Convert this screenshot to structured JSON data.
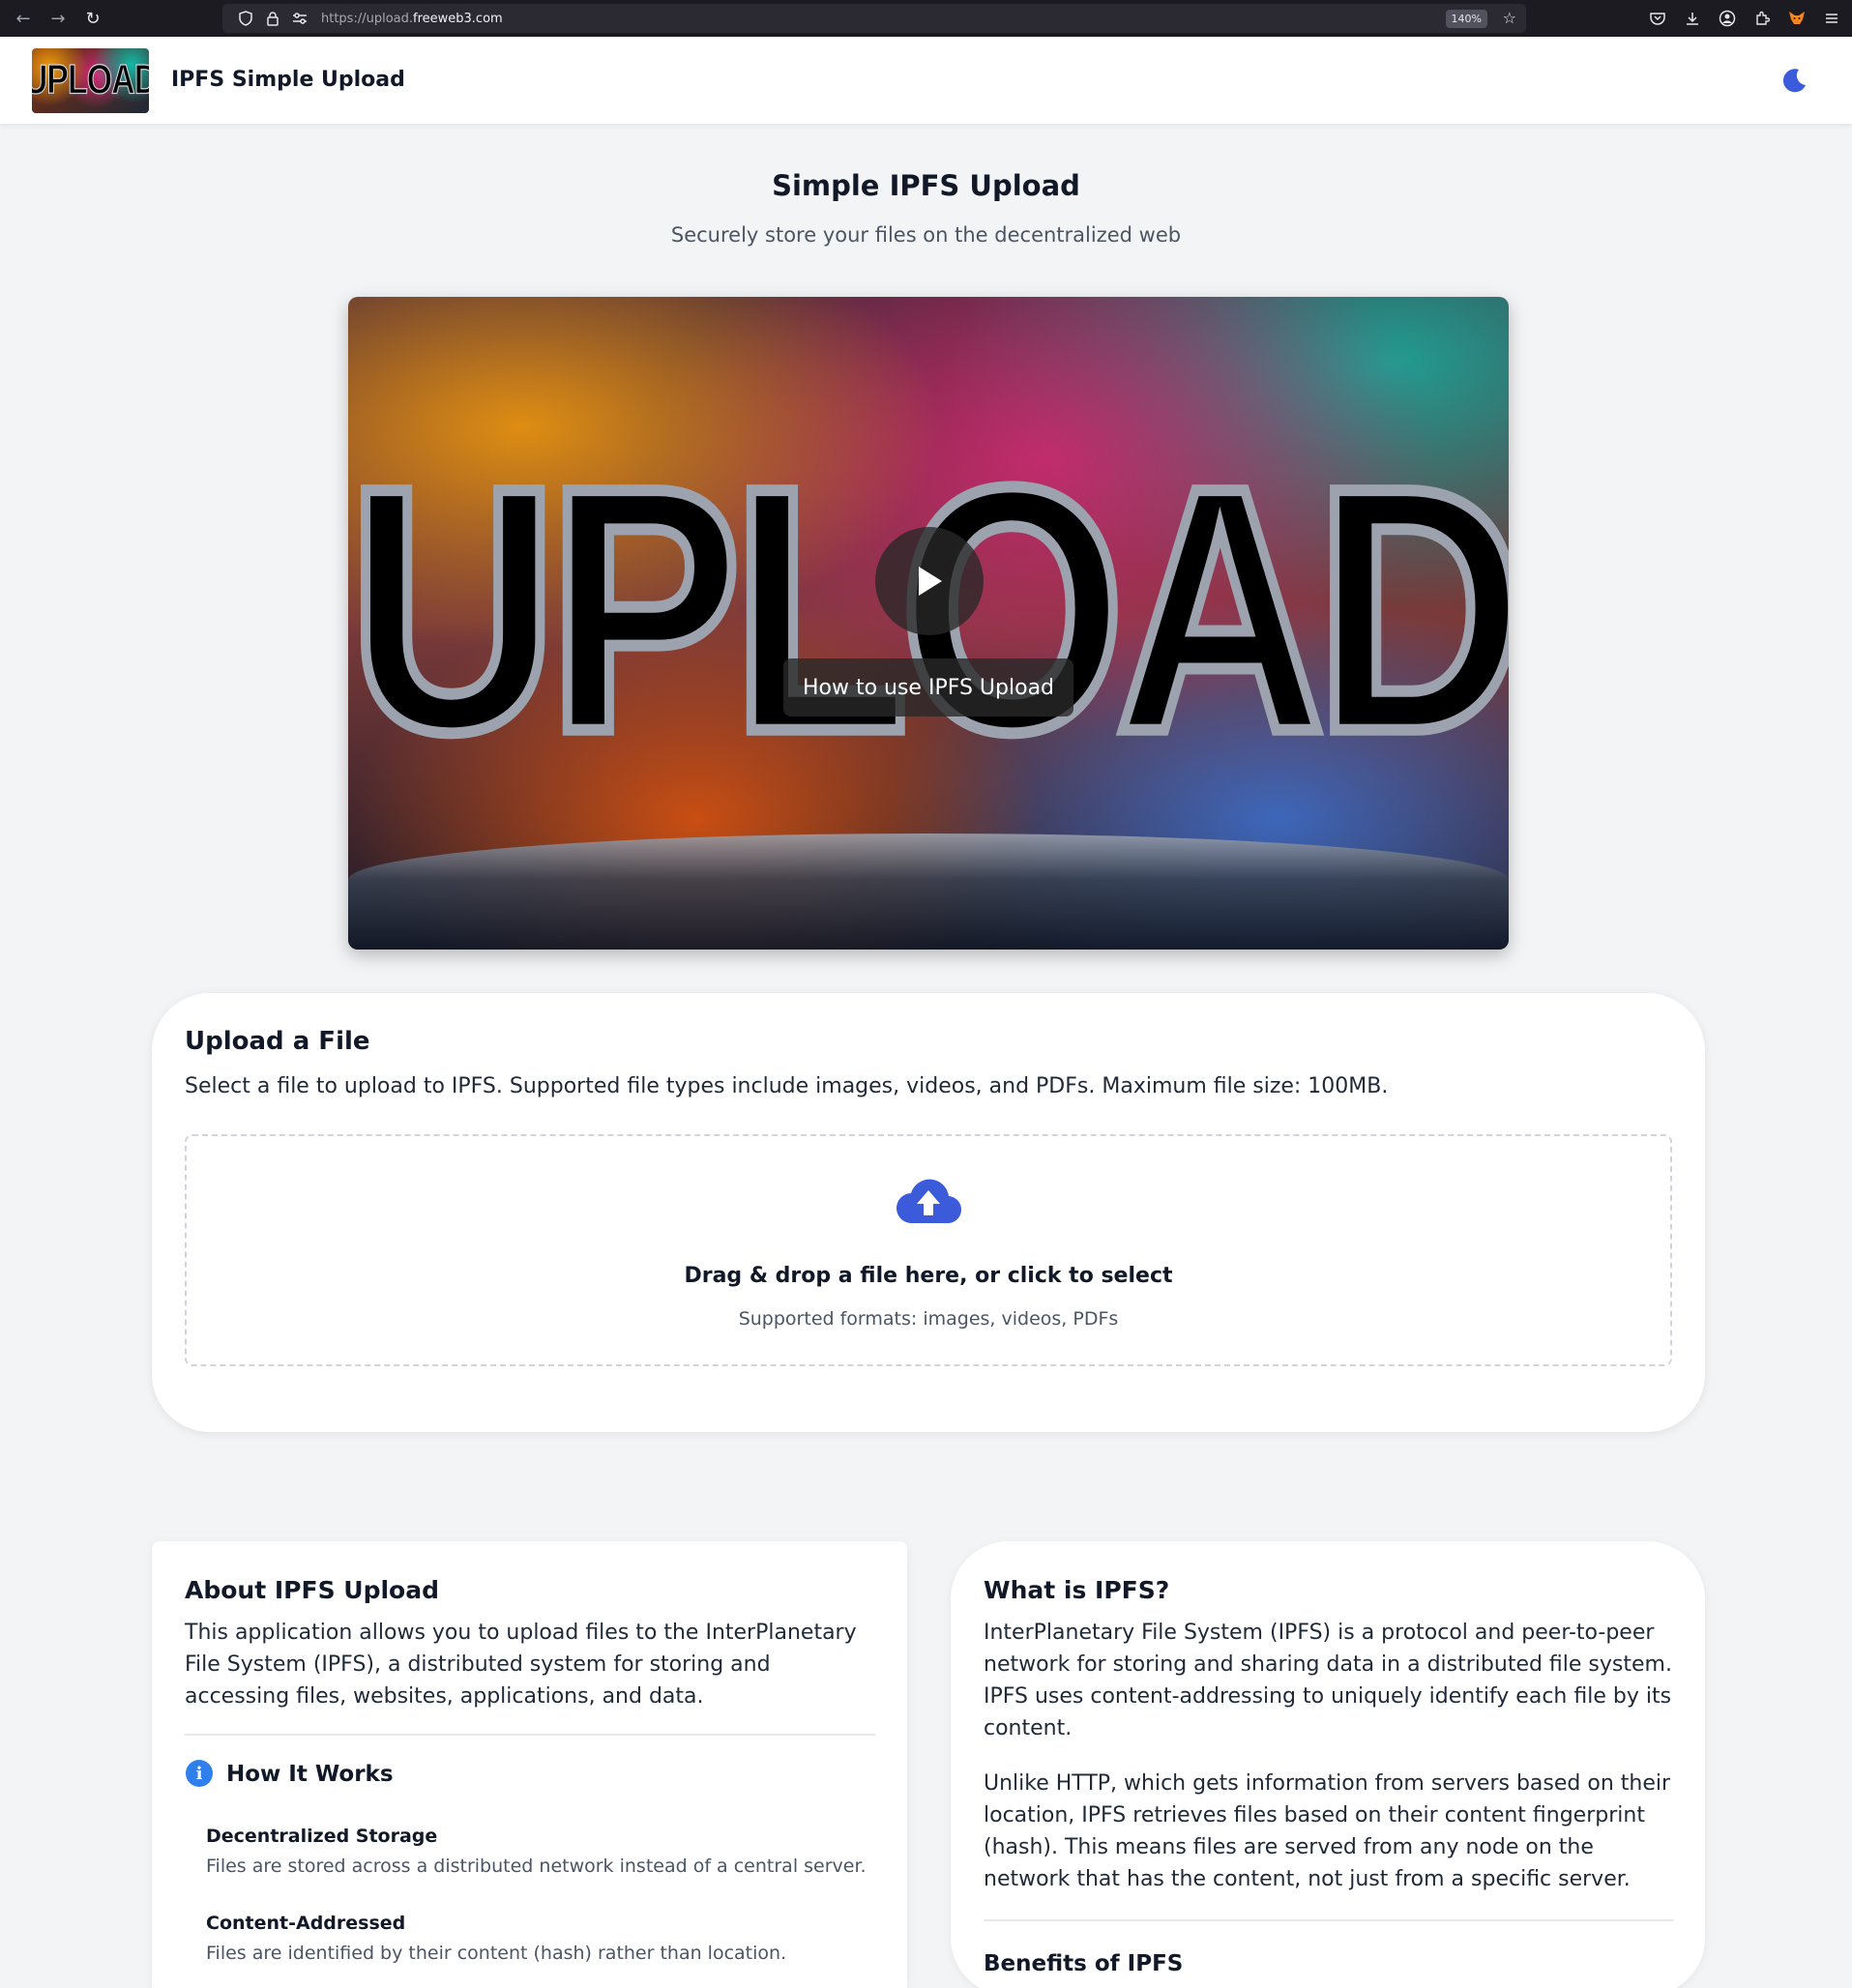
{
  "browser": {
    "url_prefix": "https://upload.",
    "url_domain": "freeweb3.com",
    "zoom": "140%"
  },
  "header": {
    "logo_text": "UPLOAD",
    "title": "IPFS Simple Upload"
  },
  "hero": {
    "title": "Simple IPFS Upload",
    "subtitle": "Securely store your files on the decentralized web"
  },
  "video": {
    "caption": "How to use IPFS Upload",
    "thumbnail_word": "UPLOAD"
  },
  "upload": {
    "title": "Upload a File",
    "description": "Select a file to upload to IPFS. Supported file types include images, videos, and PDFs. Maximum file size: 100MB.",
    "drop_title": "Drag & drop a file here, or click to select",
    "drop_sub": "Supported formats: images, videos, PDFs"
  },
  "about": {
    "title": "About IPFS Upload",
    "text": "This application allows you to upload files to the InterPlanetary File System (IPFS), a distributed system for storing and accessing files, websites, applications, and data.",
    "how_title": "How It Works",
    "features": [
      {
        "title": "Decentralized Storage",
        "desc": "Files are stored across a distributed network instead of a central server."
      },
      {
        "title": "Content-Addressed",
        "desc": "Files are identified by their content (hash) rather than location."
      }
    ]
  },
  "ipfs": {
    "title": "What is IPFS?",
    "para1": "InterPlanetary File System (IPFS) is a protocol and peer-to-peer network for storing and sharing data in a distributed file system. IPFS uses content-addressing to uniquely identify each file by its content.",
    "para2": "Unlike HTTP, which gets information from servers based on their location, IPFS retrieves files based on their content fingerprint (hash). This means files are served from any node on the network that has the content, not just from a specific server.",
    "benefits_title": "Benefits of IPFS"
  },
  "colors": {
    "accent": "#3b5bdb",
    "info": "#2f80ed"
  }
}
